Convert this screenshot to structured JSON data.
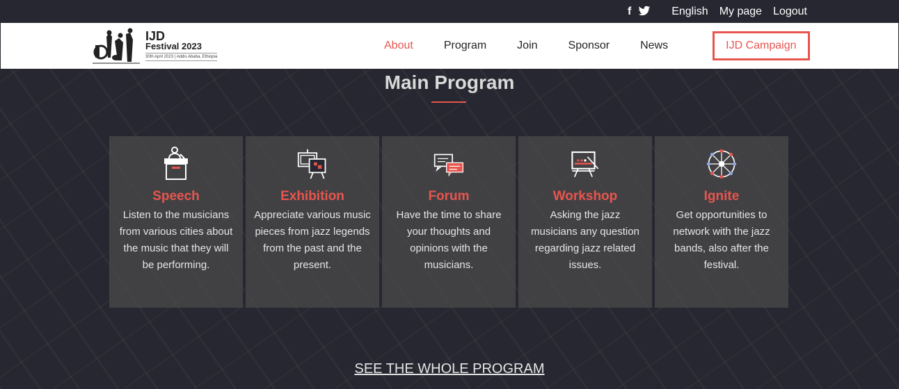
{
  "topbar": {
    "social": [
      {
        "icon": "facebook-icon",
        "glyph": "f"
      },
      {
        "icon": "twitter-icon",
        "glyph": "🐦"
      }
    ],
    "links": [
      "English",
      "My page",
      "Logout"
    ]
  },
  "logo": {
    "title": "IJD",
    "subtitle": "Festival 2023",
    "date_line": "30th April 2023 | Addis Ababa, Ethiopia"
  },
  "nav": {
    "items": [
      "About",
      "Program",
      "Join",
      "Sponsor",
      "News"
    ],
    "active": "About",
    "campaign": "IJD Campaign"
  },
  "main": {
    "title": "Main Program",
    "cards": [
      {
        "icon": "podium-icon",
        "title": "Speech",
        "desc": "Listen to the musicians from various cities about the music that they will be performing."
      },
      {
        "icon": "easel-gallery-icon",
        "title": "Exhibition",
        "desc": "Appreciate various music pieces from jazz legends from the past and the present."
      },
      {
        "icon": "chat-bubbles-icon",
        "title": "Forum",
        "desc": "Have the time to share your thoughts and opinions with the musicians."
      },
      {
        "icon": "whiteboard-icon",
        "title": "Workshop",
        "desc": "Asking the jazz musicians any question regarding jazz related issues."
      },
      {
        "icon": "network-icon",
        "title": "Ignite",
        "desc": "Get opportunities to network with the jazz bands, also after the festival."
      }
    ],
    "see_all": "SEE THE WHOLE PROGRAM"
  },
  "colors": {
    "accent": "#e8554e",
    "background": "#262730",
    "card": "#4b4b4b"
  }
}
